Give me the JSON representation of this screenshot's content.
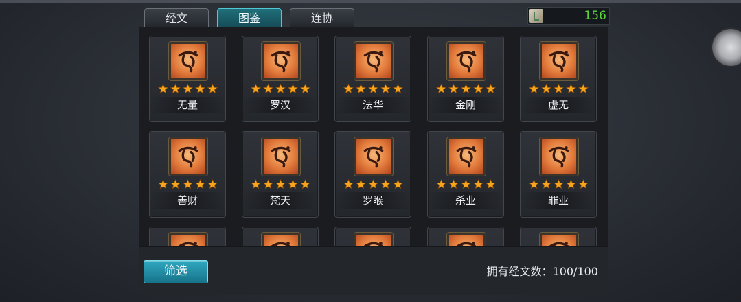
{
  "tabs": [
    {
      "label": "经文",
      "active": false
    },
    {
      "label": "图鉴",
      "active": true
    },
    {
      "label": "连协",
      "active": false
    }
  ],
  "currency": {
    "icon": "scroll-icon",
    "value": "156",
    "value_color": "#5bd33f"
  },
  "cards": [
    {
      "name": "无量",
      "stars": 5,
      "glyph": "sanskrit-seal-icon"
    },
    {
      "name": "罗汉",
      "stars": 5,
      "glyph": "sanskrit-seal-icon"
    },
    {
      "name": "法华",
      "stars": 5,
      "glyph": "sanskrit-seal-icon"
    },
    {
      "name": "金刚",
      "stars": 5,
      "glyph": "sanskrit-seal-icon"
    },
    {
      "name": "虚无",
      "stars": 5,
      "glyph": "sanskrit-seal-icon"
    },
    {
      "name": "善财",
      "stars": 5,
      "glyph": "sanskrit-seal-icon"
    },
    {
      "name": "梵天",
      "stars": 5,
      "glyph": "sanskrit-seal-icon"
    },
    {
      "name": "罗睺",
      "stars": 5,
      "glyph": "sanskrit-seal-icon"
    },
    {
      "name": "杀业",
      "stars": 5,
      "glyph": "sanskrit-seal-icon"
    },
    {
      "name": "罪业",
      "stars": 5,
      "glyph": "sanskrit-seal-icon"
    }
  ],
  "footer": {
    "filter_label": "筛选",
    "owned_text": "拥有经文数：100/100"
  },
  "colors": {
    "accent": "#2fa8c0",
    "star": "#f6a51c",
    "seal": "#e27a3b"
  }
}
